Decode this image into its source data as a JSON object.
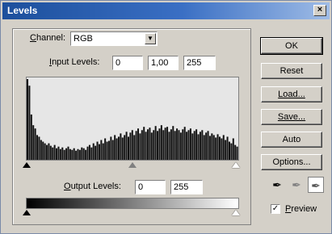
{
  "window": {
    "title": "Levels",
    "close_glyph": "×"
  },
  "channel": {
    "label_prefix": "",
    "label_underlined": "C",
    "label_rest": "hannel:",
    "value": "RGB"
  },
  "input_levels": {
    "label_underlined": "I",
    "label_rest": "nput Levels:",
    "black": "0",
    "gamma": "1,00",
    "white": "255"
  },
  "output_levels": {
    "label_underlined": "O",
    "label_rest": "utput Levels:",
    "black": "0",
    "white": "255"
  },
  "buttons": {
    "ok": "OK",
    "reset": "Reset",
    "load": "Load...",
    "save": "Save...",
    "auto": "Auto",
    "options": "Options..."
  },
  "preview": {
    "label_underlined": "P",
    "label_rest": "review",
    "checked": true
  },
  "histogram": {
    "bins": [
      98,
      90,
      55,
      42,
      38,
      30,
      28,
      24,
      22,
      20,
      18,
      20,
      17,
      15,
      18,
      14,
      16,
      13,
      15,
      12,
      14,
      16,
      13,
      12,
      14,
      11,
      13,
      12,
      15,
      14,
      12,
      16,
      18,
      15,
      20,
      17,
      22,
      19,
      24,
      20,
      26,
      22,
      23,
      28,
      24,
      30,
      26,
      28,
      32,
      27,
      30,
      34,
      28,
      33,
      36,
      30,
      35,
      38,
      32,
      36,
      40,
      34,
      37,
      39,
      33,
      36,
      41,
      35,
      38,
      42,
      36,
      39,
      40,
      34,
      37,
      41,
      35,
      38,
      36,
      33,
      37,
      40,
      34,
      36,
      38,
      32,
      35,
      37,
      31,
      34,
      36,
      30,
      33,
      35,
      29,
      32,
      30,
      27,
      31,
      28,
      26,
      30,
      24,
      28,
      22,
      20,
      26,
      18,
      16
    ]
  }
}
